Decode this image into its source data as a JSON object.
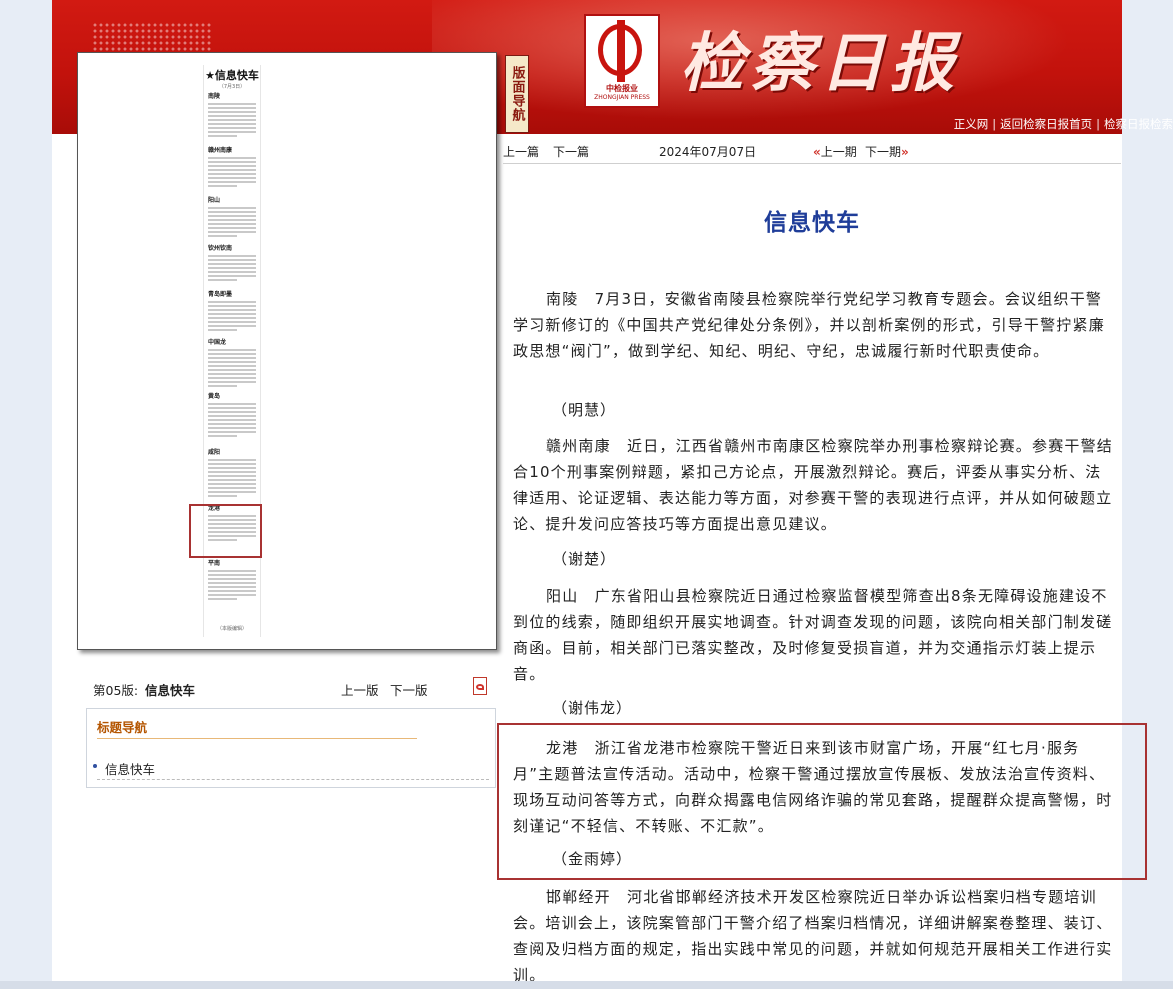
{
  "masthead": {
    "nav_tab": "版面导航",
    "logo_cn": "中检报业",
    "logo_en": "ZHONGJIAN PRESS",
    "brand": "检察日报",
    "links": [
      "正义网",
      "返回检察日报首页",
      "检察日报检索"
    ]
  },
  "colors": {
    "banner_red": "#c8140e",
    "title_blue": "#1f3d99",
    "highlight_border": "#a83232",
    "nav_head_orange": "#b45500"
  },
  "preview": {
    "title": "★信息快车",
    "date": "（7月3日）",
    "blocks": [
      "南陵",
      "赣州南康",
      "阳山",
      "钦州钦南",
      "青岛即墨",
      "中国龙",
      "黄岛",
      "咸阳",
      "龙港",
      "平南"
    ],
    "footer": "（本版编辑）"
  },
  "edition_bar": {
    "number": "第05版:",
    "name": "信息快车",
    "prev": "上一版",
    "next": "下一版",
    "pdf_icon": "pdf-icon"
  },
  "title_nav": {
    "heading": "标题导航",
    "items": [
      "信息快车"
    ]
  },
  "article_nav": {
    "prev_article": "上一篇",
    "next_article": "下一篇",
    "date": "2024年07月07日",
    "prev_issue": "上一期",
    "next_issue": "下一期"
  },
  "article": {
    "title": "信息快车",
    "paragraphs": [
      "南陵　7月3日，安徽省南陵县检察院举行党纪学习教育专题会。会议组织干警学习新修订的《中国共产党纪律处分条例》，并以剖析案例的形式，引导干警拧紧廉政思想“阀门”，做到学纪、知纪、明纪、守纪，忠诚履行新时代职责使命。",
      "赣州南康　近日，江西省赣州市南康区检察院举办刑事检察辩论赛。参赛干警结合10个刑事案例辩题，紧扣己方论点，开展激烈辩论。赛后，评委从事实分析、法律适用、论证逻辑、表达能力等方面，对参赛干警的表现进行点评，并从如何破题立论、提升发问应答技巧等方面提出意见建议。",
      "阳山　广东省阳山县检察院近日通过检察监督模型筛查出8条无障碍设施建设不到位的线索，随即组织开展实地调查。针对调查发现的问题，该院向相关部门制发磋商函。目前，相关部门已落实整改，及时修复受损盲道，并为交通指示灯装上提示音。",
      "龙港　浙江省龙港市检察院干警近日来到该市财富广场，开展“红七月·服务月”主题普法宣传活动。活动中，检察干警通过摆放宣传展板、发放法治宣传资料、现场互动问答等方式，向群众揭露电信网络诈骗的常见套路，提醒群众提高警惕，时刻谨记“不轻信、不转账、不汇款”。",
      "邯郸经开　河北省邯郸经济技术开发区检察院近日举办诉讼档案归档专题培训会。培训会上，该院案管部门干警介绍了档案归档情况，详细讲解案卷整理、装订、查阅及归档方面的规定，指出实践中常见的问题，并就如何规范开展相关工作进行实训。"
    ],
    "authors": [
      "（明慧）",
      "（谢楚）",
      "（谢伟龙）",
      "（金雨婷）"
    ]
  }
}
